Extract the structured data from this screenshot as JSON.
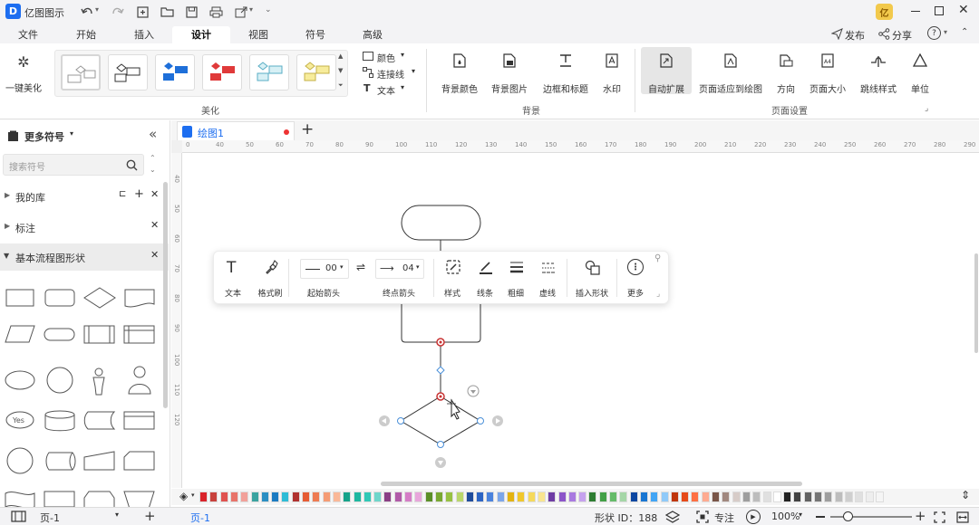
{
  "app": {
    "title": "亿图图示"
  },
  "tabs": [
    "文件",
    "开始",
    "插入",
    "设计",
    "视图",
    "符号",
    "高级"
  ],
  "active_tab": "设计",
  "top_right": {
    "publish": "发布",
    "share": "分享"
  },
  "ribbon": {
    "beautify": {
      "one_click": "一键美化",
      "group_label": "美化"
    },
    "options": {
      "color": "颜色",
      "connector": "连接线",
      "text": "文本"
    },
    "background": {
      "bg_color": "背景颜色",
      "bg_image": "背景图片",
      "border_title": "边框和标题",
      "watermark": "水印",
      "group_label": "背景"
    },
    "page_setup": {
      "auto_expand": "自动扩展",
      "fit_page": "页面适应到绘图",
      "direction": "方向",
      "page_size": "页面大小",
      "jump_style": "跳线样式",
      "unit": "单位",
      "group_label": "页面设置"
    }
  },
  "left_panel": {
    "title": "更多符号",
    "search_placeholder": "搜索符号",
    "sections": [
      "我的库",
      "标注",
      "基本流程图形状"
    ]
  },
  "doc": {
    "tab_name": "绘图1"
  },
  "ruler": {
    "h": [
      "0",
      "40",
      "50",
      "60",
      "70",
      "80",
      "90",
      "100",
      "110",
      "120",
      "130",
      "140",
      "150",
      "160",
      "170",
      "180",
      "190",
      "200",
      "210",
      "220",
      "230",
      "240",
      "250",
      "260",
      "270",
      "280",
      "290"
    ],
    "v": [
      "40",
      "50",
      "60",
      "70",
      "80",
      "90",
      "100",
      "110",
      "120"
    ]
  },
  "floatbar": {
    "text": "文本",
    "format_brush": "格式刷",
    "start_arrow": "起始箭头",
    "start_value": "00",
    "end_arrow": "终点箭头",
    "end_value": "04",
    "style": "样式",
    "line": "线条",
    "weight": "粗细",
    "dash": "虚线",
    "insert_shape": "插入形状",
    "more": "更多"
  },
  "shapes": {
    "yes_label": "Yes"
  },
  "palette_colors": [
    "#d9232a",
    "#c8413c",
    "#e0524f",
    "#e8746a",
    "#f2a19a",
    "#3aa3a0",
    "#2b8fc3",
    "#1b7bc1",
    "#2ebcd6",
    "#b0322f",
    "#e65c34",
    "#ee7b52",
    "#f59b74",
    "#fab898",
    "#15a38a",
    "#1eb7a0",
    "#30c8b6",
    "#6fd6cb",
    "#8a3f85",
    "#b15aa8",
    "#d57dc6",
    "#e8a6db",
    "#5b8f28",
    "#79a832",
    "#97c142",
    "#b9d66a",
    "#1f4c9c",
    "#2d65c4",
    "#4b83dd",
    "#7ba6ea",
    "#e3b312",
    "#f0c72c",
    "#f5d95b",
    "#f9e58f",
    "#6f3da4",
    "#8c55c9",
    "#a97ae0",
    "#c6a2ee",
    "#2e7d32",
    "#43a047",
    "#66bb6a",
    "#a5d6a7",
    "#0d47a1",
    "#1976d2",
    "#42a5f5",
    "#90caf9",
    "#bf360c",
    "#e64a19",
    "#ff7043",
    "#ffab91",
    "#795548",
    "#a1887f",
    "#d7ccc8",
    "#9e9e9e",
    "#bdbdbd",
    "#e0e0e0",
    "#ffffff",
    "#212121",
    "#424242",
    "#616161",
    "#757575",
    "#9e9e9e",
    "#bdbdbd",
    "#cfcfcf",
    "#e0e0e0",
    "#eeeeee",
    "#f5f5f5"
  ],
  "status": {
    "page_selector": "页-1",
    "page_tab": "页-1",
    "shape_id": "形状 ID：188",
    "focus": "专注",
    "zoom": "100%"
  }
}
